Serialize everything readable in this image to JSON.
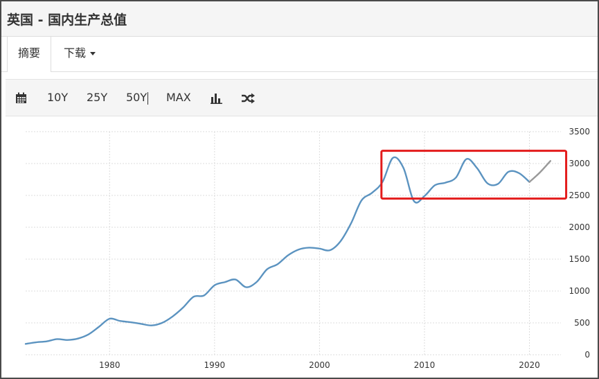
{
  "page": {
    "title": "英国 - 国内生产总值"
  },
  "tabs": [
    {
      "label": "摘要",
      "active": true
    },
    {
      "label": "下载",
      "has_dropdown": true
    }
  ],
  "toolbar": {
    "calendar_icon": "calendar-icon",
    "ranges": [
      "10Y",
      "25Y",
      "50Y",
      "MAX"
    ],
    "chart_type_icon": "bar-chart-icon",
    "shuffle_icon": "shuffle-icon"
  },
  "colors": {
    "line": "#5b93c0",
    "forecast_line": "#999999",
    "highlight_box": "#e31b1b",
    "grid": "#dcdcdc"
  },
  "chart_data": {
    "type": "line",
    "title": "",
    "xlabel": "",
    "ylabel": "",
    "xlim": [
      1972,
      2023
    ],
    "ylim": [
      0,
      3500
    ],
    "x_ticks": [
      1980,
      1990,
      2000,
      2010,
      2020
    ],
    "y_ticks": [
      0,
      500,
      1000,
      1500,
      2000,
      2500,
      3000,
      3500
    ],
    "y_axis_position": "right",
    "grid": true,
    "legend": "none",
    "series": [
      {
        "values": [
          [
            1972,
            170
          ],
          [
            1973,
            195
          ],
          [
            1974,
            210
          ],
          [
            1975,
            245
          ],
          [
            1976,
            232
          ],
          [
            1977,
            255
          ],
          [
            1978,
            320
          ],
          [
            1979,
            440
          ],
          [
            1980,
            565
          ],
          [
            1981,
            530
          ],
          [
            1982,
            510
          ],
          [
            1983,
            485
          ],
          [
            1984,
            460
          ],
          [
            1985,
            500
          ],
          [
            1986,
            600
          ],
          [
            1987,
            740
          ],
          [
            1988,
            910
          ],
          [
            1989,
            930
          ],
          [
            1990,
            1090
          ],
          [
            1991,
            1140
          ],
          [
            1992,
            1180
          ],
          [
            1993,
            1060
          ],
          [
            1994,
            1140
          ],
          [
            1995,
            1340
          ],
          [
            1996,
            1420
          ],
          [
            1997,
            1560
          ],
          [
            1998,
            1650
          ],
          [
            1999,
            1680
          ],
          [
            2000,
            1665
          ],
          [
            2001,
            1640
          ],
          [
            2002,
            1780
          ],
          [
            2003,
            2060
          ],
          [
            2004,
            2420
          ],
          [
            2005,
            2540
          ],
          [
            2006,
            2710
          ],
          [
            2007,
            3090
          ],
          [
            2008,
            2930
          ],
          [
            2009,
            2410
          ],
          [
            2010,
            2490
          ],
          [
            2011,
            2660
          ],
          [
            2012,
            2700
          ],
          [
            2013,
            2780
          ],
          [
            2014,
            3070
          ],
          [
            2015,
            2930
          ],
          [
            2016,
            2690
          ],
          [
            2017,
            2680
          ],
          [
            2018,
            2870
          ],
          [
            2019,
            2850
          ],
          [
            2020,
            2710
          ]
        ]
      },
      {
        "values": [
          [
            2020,
            2710
          ],
          [
            2021,
            2860
          ],
          [
            2022,
            3040
          ]
        ]
      }
    ],
    "annotations": [
      {
        "type": "rect",
        "x_range": [
          2005.9,
          2023.5
        ],
        "y_range": [
          2450,
          3200
        ]
      }
    ]
  }
}
